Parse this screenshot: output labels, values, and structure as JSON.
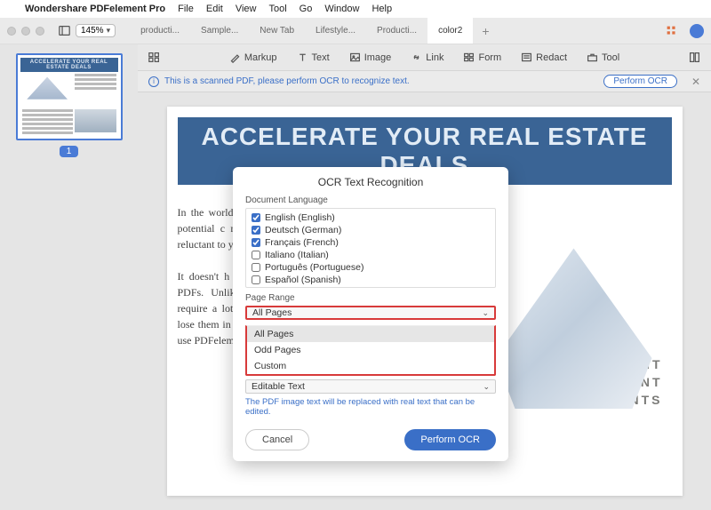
{
  "menubar": {
    "app": "Wondershare PDFelement Pro",
    "items": [
      "File",
      "Edit",
      "View",
      "Tool",
      "Go",
      "Window",
      "Help"
    ]
  },
  "titlebar": {
    "zoom": "145%",
    "tabs": [
      "producti...",
      "Sample...",
      "New Tab",
      "Lifestyle...",
      "Producti...",
      "color2"
    ],
    "active_tab": 5
  },
  "toolbar": {
    "markup": "Markup",
    "text": "Text",
    "image": "Image",
    "link": "Link",
    "form": "Form",
    "redact": "Redact",
    "tool": "Tool"
  },
  "ocrbar": {
    "msg": "This is a scanned PDF, please perform OCR to recognize text.",
    "action": "Perform OCR"
  },
  "sidebar": {
    "page_number": "1",
    "thumb_title": "ACCELERATE YOUR REAL ESTATE DEALS"
  },
  "document": {
    "hero": "ACCELERATE YOUR REAL ESTATE DEALS",
    "paragraph1": "In the world organization has a hu how your potential c not able t file system other busi reluctant to you.",
    "paragraph2": "It doesn't h have paper To resolve transition PDFs. Unlike Paper, PDF documents don't require a lot of storage space. You also can't lose them in terrible incidents like a fire if you use PDFelement to",
    "caption1": "SEAMLESSLY EDIT JOINT TENANT",
    "caption2": "AGREEMENTS"
  },
  "modal": {
    "title": "OCR Text Recognition",
    "lang_label": "Document Language",
    "languages": [
      {
        "label": "English (English)",
        "checked": true
      },
      {
        "label": "Deutsch (German)",
        "checked": true
      },
      {
        "label": "Français (French)",
        "checked": true
      },
      {
        "label": "Italiano (Italian)",
        "checked": false
      },
      {
        "label": "Português (Portuguese)",
        "checked": false
      },
      {
        "label": "Español (Spanish)",
        "checked": false
      }
    ],
    "range_label": "Page Range",
    "range_value": "All Pages",
    "range_options": [
      "All Pages",
      "Odd Pages",
      "Custom"
    ],
    "output_value": "Editable Text",
    "note": "The PDF image text will be replaced with real text that can be edited.",
    "cancel": "Cancel",
    "confirm": "Perform OCR"
  }
}
